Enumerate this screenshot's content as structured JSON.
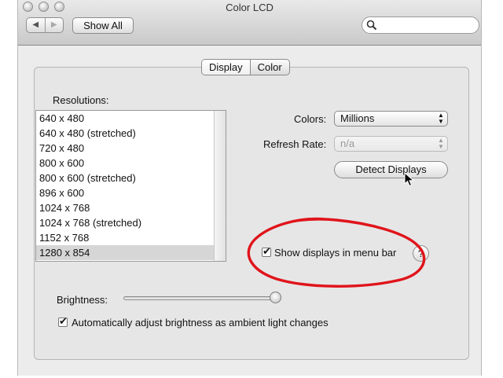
{
  "window": {
    "title": "Color LCD",
    "show_all_label": "Show All",
    "nav_back_icon": "◀",
    "nav_forward_icon": "▶",
    "search_placeholder": ""
  },
  "tabs": [
    {
      "label": "Display",
      "selected": true
    },
    {
      "label": "Color",
      "selected": false
    }
  ],
  "resolutions": {
    "label": "Resolutions:",
    "items": [
      "640 x 480",
      "640 x 480 (stretched)",
      "720 x 480",
      "800 x 600",
      "800 x 600 (stretched)",
      "896 x 600",
      "1024 x 768",
      "1024 x 768 (stretched)",
      "1152 x 768",
      "1280 x 854"
    ],
    "selected": "1280 x 854"
  },
  "colors": {
    "label": "Colors:",
    "value": "Millions"
  },
  "refresh_rate": {
    "label": "Refresh Rate:",
    "value": "n/a",
    "enabled": false
  },
  "detect_displays_label": "Detect Displays",
  "show_in_menu_bar": {
    "label": "Show displays in menu bar",
    "checked": true
  },
  "help_label": "?",
  "brightness": {
    "label": "Brightness:",
    "level": 1.0
  },
  "auto_brightness": {
    "label": "Automatically adjust brightness as ambient light changes",
    "checked": true
  },
  "colors_meta": {
    "annotation": "#e0141b",
    "selection": "#d6d6d6"
  }
}
